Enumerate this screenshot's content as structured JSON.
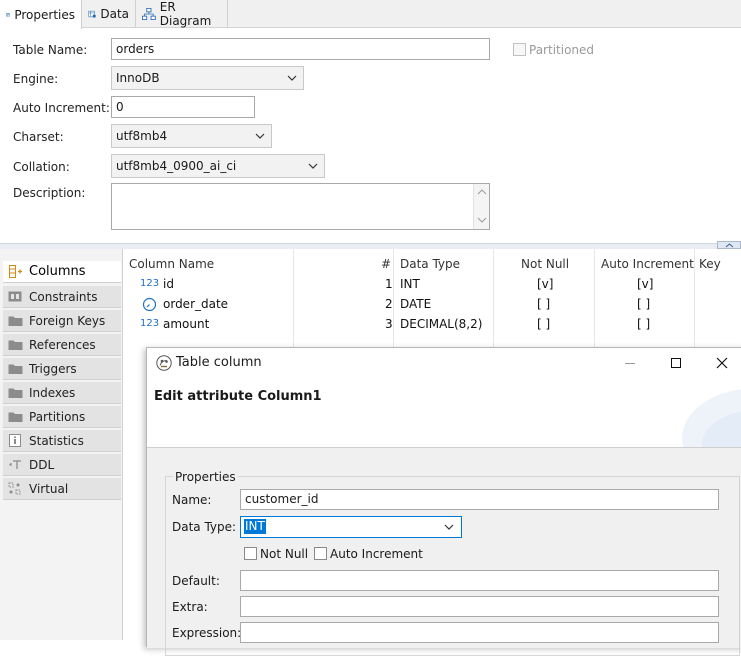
{
  "tabs": [
    {
      "label": "Properties",
      "icon": "properties-table-icon"
    },
    {
      "label": "Data",
      "icon": "data-grid-icon"
    },
    {
      "label": "ER Diagram",
      "icon": "er-diagram-icon"
    }
  ],
  "form": {
    "table_name_label": "Table Name:",
    "table_name": "orders",
    "partitioned_label": "Partitioned",
    "engine_label": "Engine:",
    "engine": "InnoDB",
    "auto_increment_label": "Auto Increment:",
    "auto_increment": "0",
    "charset_label": "Charset:",
    "charset": "utf8mb4",
    "collation_label": "Collation:",
    "collation": "utf8mb4_0900_ai_ci",
    "description_label": "Description:",
    "description": ""
  },
  "sidebar": {
    "items": [
      {
        "label": "Columns",
        "icon": "columns-icon"
      },
      {
        "label": "Constraints",
        "icon": "constraints-icon"
      },
      {
        "label": "Foreign Keys",
        "icon": "folder-icon"
      },
      {
        "label": "References",
        "icon": "folder-icon"
      },
      {
        "label": "Triggers",
        "icon": "folder-icon"
      },
      {
        "label": "Indexes",
        "icon": "folder-icon"
      },
      {
        "label": "Partitions",
        "icon": "folder-icon"
      },
      {
        "label": "Statistics",
        "icon": "info-icon"
      },
      {
        "label": "DDL",
        "icon": "ddl-icon"
      },
      {
        "label": "Virtual",
        "icon": "virtual-icon"
      }
    ]
  },
  "columns_table": {
    "headers": [
      "Column Name",
      "#",
      "Data Type",
      "Not Null",
      "Auto Increment",
      "Key"
    ],
    "rows": [
      {
        "type_icon": "123",
        "name": "id",
        "num": "1",
        "data_type": "INT",
        "not_null": "[v]",
        "auto_inc": "[v]"
      },
      {
        "type_icon": "clock",
        "name": "order_date",
        "num": "2",
        "data_type": "DATE",
        "not_null": "[ ]",
        "auto_inc": "[ ]"
      },
      {
        "type_icon": "123",
        "name": "amount",
        "num": "3",
        "data_type": "DECIMAL(8,2)",
        "not_null": "[ ]",
        "auto_inc": "[ ]"
      }
    ]
  },
  "dialog": {
    "title": "Table column",
    "heading": "Edit attribute Column1",
    "group_label": "Properties",
    "name_label": "Name:",
    "name_value": "customer_id",
    "data_type_label": "Data Type:",
    "data_type_value": "INT",
    "not_null_label": "Not Null",
    "auto_increment_label": "Auto Increment",
    "default_label": "Default:",
    "default_value": "",
    "extra_label": "Extra:",
    "extra_value": "",
    "expression_label": "Expression:",
    "expression_value": ""
  },
  "colors": {
    "selection": "#0078d7",
    "accent_blue": "#1e6fc4",
    "dialog_body": "#f0f0f0"
  }
}
